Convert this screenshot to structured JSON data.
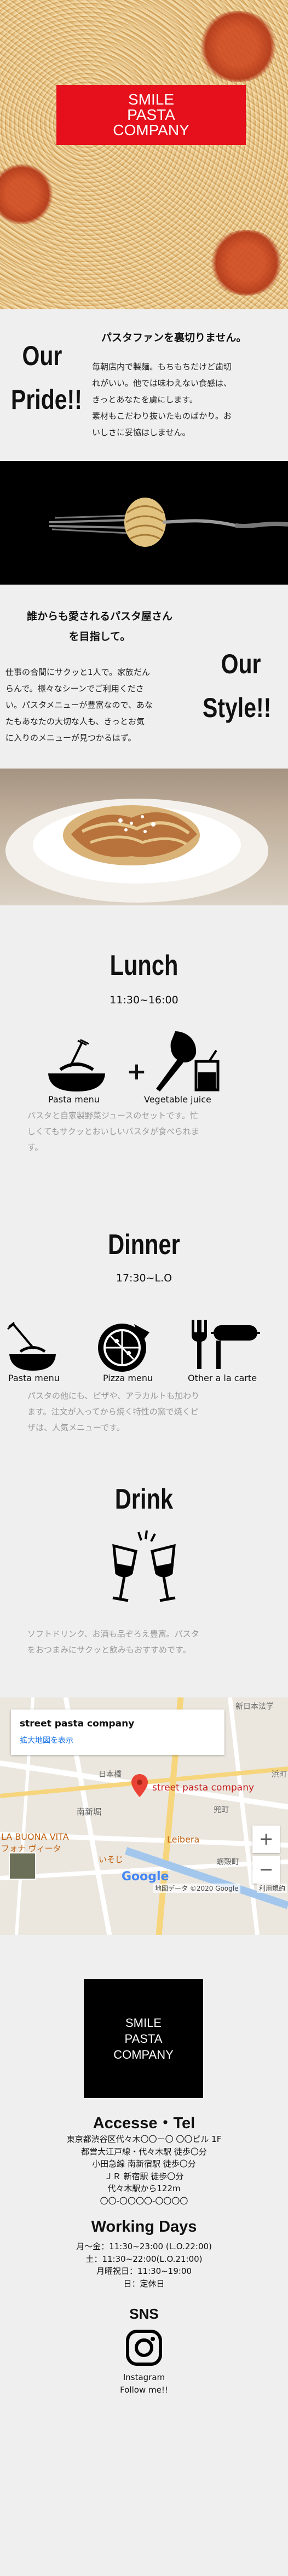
{
  "hero": {
    "logo_lines": [
      "SMILE",
      "PASTA",
      "COMPANY"
    ]
  },
  "pride": {
    "title_lines": [
      "Our",
      "Pride!!"
    ],
    "heading": "パスタファンを裏切りません。",
    "body_lines": [
      "毎朝店内で製麺。もちもちだけど歯切",
      "れがいい。他では味わえない食感は、",
      "きっとあなたを虜にします。",
      "素材もこだわり抜いたものばかり。お",
      "いしさに妥協はしません。"
    ]
  },
  "style": {
    "heading_lines": [
      "誰からも愛されるパスタ屋さん",
      "を目指して。"
    ],
    "title_lines": [
      "Our",
      "Style!!"
    ],
    "body_lines": [
      "仕事の合間にサクッと1人で。家族だん",
      "らんで。様々なシーンでご利用くださ",
      "い。パスタメニューが豊富なので、あな",
      "たもあなたの大切な人も、きっとお気",
      "に入りのメニューが見つかるはず。"
    ]
  },
  "lunch": {
    "title": "Lunch",
    "time": "11:30~16:00",
    "items": [
      "Pasta menu",
      "Vegetable juice"
    ],
    "desc_lines": [
      "パスタと自家製野菜ジュースのセットです。忙",
      "しくてもサクッとおいしいパスタが食べられま",
      "す。"
    ]
  },
  "dinner": {
    "title": "Dinner",
    "time": "17:30~L.O",
    "items": [
      "Pasta menu",
      "Pizza menu",
      "Other a la carte"
    ],
    "desc_lines": [
      "パスタの他にも、ピザや、アラカルトも加わり",
      "ます。注文が入ってから焼く特性の窯で焼くピ",
      "ザは、人気メニューです。"
    ]
  },
  "drink": {
    "title": "Drink",
    "desc_lines": [
      "ソフトドリンク、お酒も品ぞろえ豊富。パスタ",
      "をおつまみにサクッと飲みもおすすめです。"
    ]
  },
  "map": {
    "place_name": "street pasta company",
    "larger_map": "拡大地図を表示",
    "pin_label": "street pasta company",
    "labels": [
      "新日本法学",
      "浜町",
      "南新堀",
      "LA BUONA VITA",
      "フォナ ヴィータ",
      "Leibera",
      "いそじ",
      "日本橋",
      "兜町",
      "蛎殻町"
    ],
    "google": "Google",
    "attribution": [
      "地図データ ©2020 Google",
      "利用規約"
    ]
  },
  "footer": {
    "logo_lines": [
      "SMILE",
      "PASTA",
      "COMPANY"
    ],
    "access_title": "Accesse・Tel",
    "access_lines": [
      "東京都渋谷区代々木〇〇ー〇 〇〇ビル 1F",
      "都営大江戸線・代々木駅 徒歩〇分",
      "小田急線 南新宿駅 徒歩〇分",
      "ＪＲ 新宿駅 徒歩〇分",
      "代々木駅から122m",
      "〇〇-〇〇〇〇-〇〇〇〇"
    ],
    "hours_title": "Working Days",
    "hours_lines": [
      "月〜金：11:30~23:00 (L.O.22:00)",
      "土：11:30~22:00(L.O.21:00)",
      "月曜祝日：11:30~19:00",
      "日：定休日"
    ],
    "sns_title": "SNS",
    "sns_lines": [
      "Instagram",
      "Follow me!!"
    ]
  },
  "colors": {
    "brand_red": "#e5101b",
    "black": "#000000",
    "muted_text": "#9a9a9a",
    "map_link": "#1a73e8"
  }
}
